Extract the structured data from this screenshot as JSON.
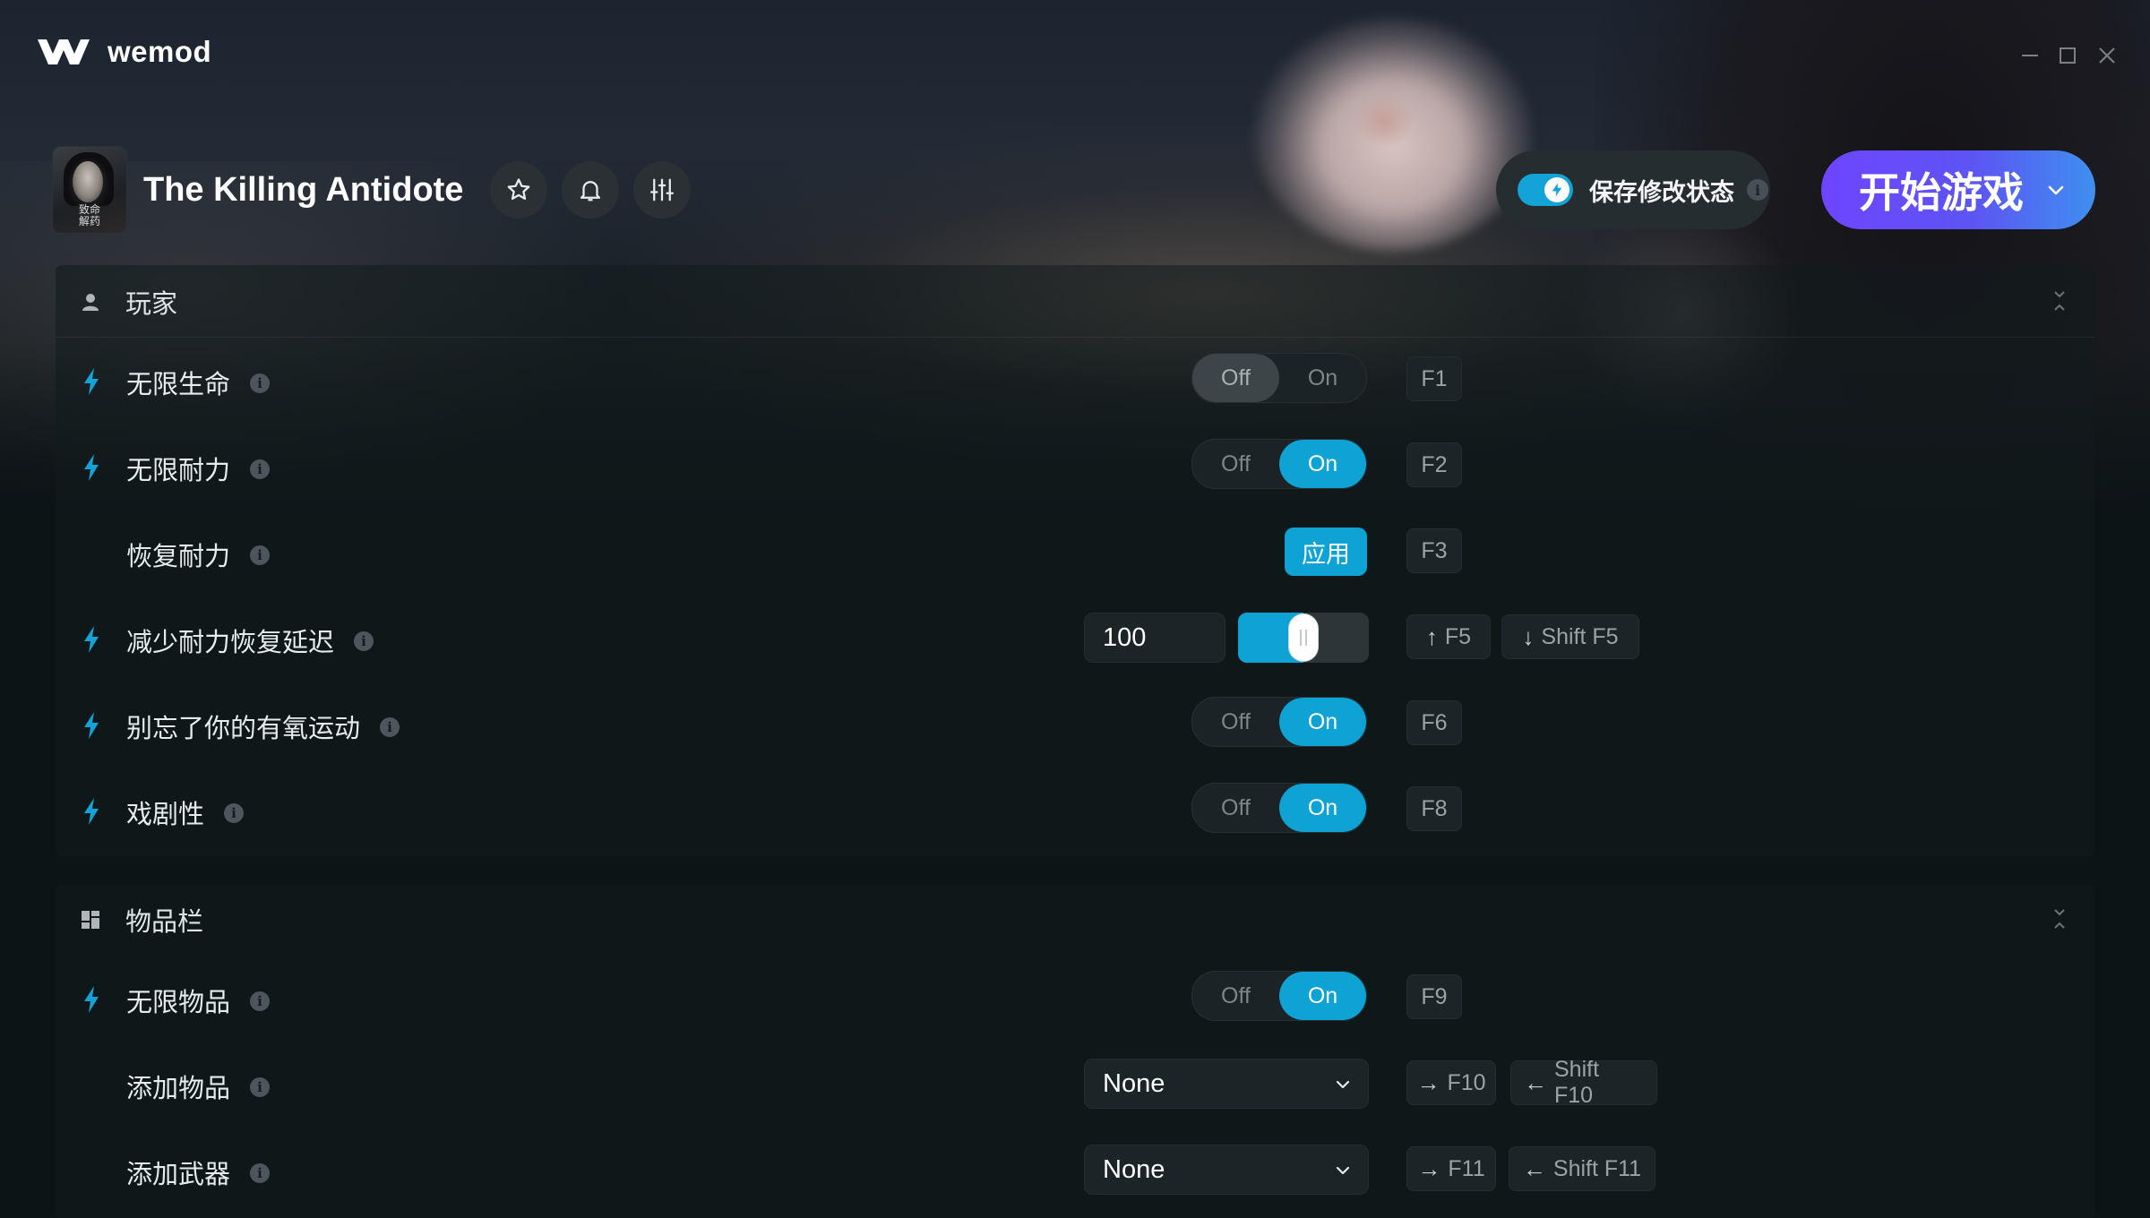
{
  "app": {
    "name": "wemod",
    "window_controls": [
      "minimize-icon",
      "maximize-icon",
      "close-icon"
    ]
  },
  "game": {
    "title": "The Killing Antidote",
    "cover_text": [
      "致命",
      "解药"
    ],
    "actions": [
      "star-icon",
      "bell-icon",
      "sliders-icon"
    ]
  },
  "save_mods": {
    "label": "保存修改状态",
    "enabled": true,
    "info": "i"
  },
  "play": {
    "label": "开始游戏"
  },
  "colors": {
    "accent": "#0fa3d5",
    "play_start": "#6e45ff",
    "play_end": "#3f8ff0",
    "background": "#0c1416"
  },
  "sections": [
    {
      "title": "玩家",
      "icon": "user-icon",
      "rows": [
        {
          "label": "无限生命",
          "bolt": true,
          "control": "toggle",
          "state": "Off",
          "off": "Off",
          "on": "On",
          "hotkeys": [
            "F1"
          ]
        },
        {
          "label": "无限耐力",
          "bolt": true,
          "control": "toggle",
          "state": "On",
          "off": "Off",
          "on": "On",
          "hotkeys": [
            "F2"
          ]
        },
        {
          "label": "恢复耐力",
          "bolt": false,
          "control": "button",
          "button_label": "应用",
          "hotkeys": [
            "F3"
          ]
        },
        {
          "label": "减少耐力恢复延迟",
          "bolt": true,
          "control": "slider",
          "value": "100",
          "fill_fraction": 0.5,
          "hotkeys": [
            {
              "arrow": "↑",
              "key": "F5"
            },
            {
              "arrow": "↓",
              "key": "Shift F5"
            }
          ]
        },
        {
          "label": "别忘了你的有氧运动",
          "bolt": true,
          "control": "toggle",
          "state": "On",
          "off": "Off",
          "on": "On",
          "hotkeys": [
            "F6"
          ]
        },
        {
          "label": "戏剧性",
          "bolt": true,
          "control": "toggle",
          "state": "On",
          "off": "Off",
          "on": "On",
          "hotkeys": [
            "F8"
          ]
        }
      ]
    },
    {
      "title": "物品栏",
      "icon": "inventory-icon",
      "rows": [
        {
          "label": "无限物品",
          "bolt": true,
          "control": "toggle",
          "state": "On",
          "off": "Off",
          "on": "On",
          "hotkeys": [
            "F9"
          ]
        },
        {
          "label": "添加物品",
          "bolt": false,
          "control": "select",
          "value": "None",
          "hotkeys": [
            {
              "arrow": "→",
              "key": "F10"
            },
            {
              "arrow": "←",
              "key": "Shift F10"
            }
          ]
        },
        {
          "label": "添加武器",
          "bolt": false,
          "control": "select",
          "value": "None",
          "hotkeys": [
            {
              "arrow": "→",
              "key": "F11"
            },
            {
              "arrow": "←",
              "key": "Shift F11"
            }
          ]
        }
      ]
    }
  ]
}
